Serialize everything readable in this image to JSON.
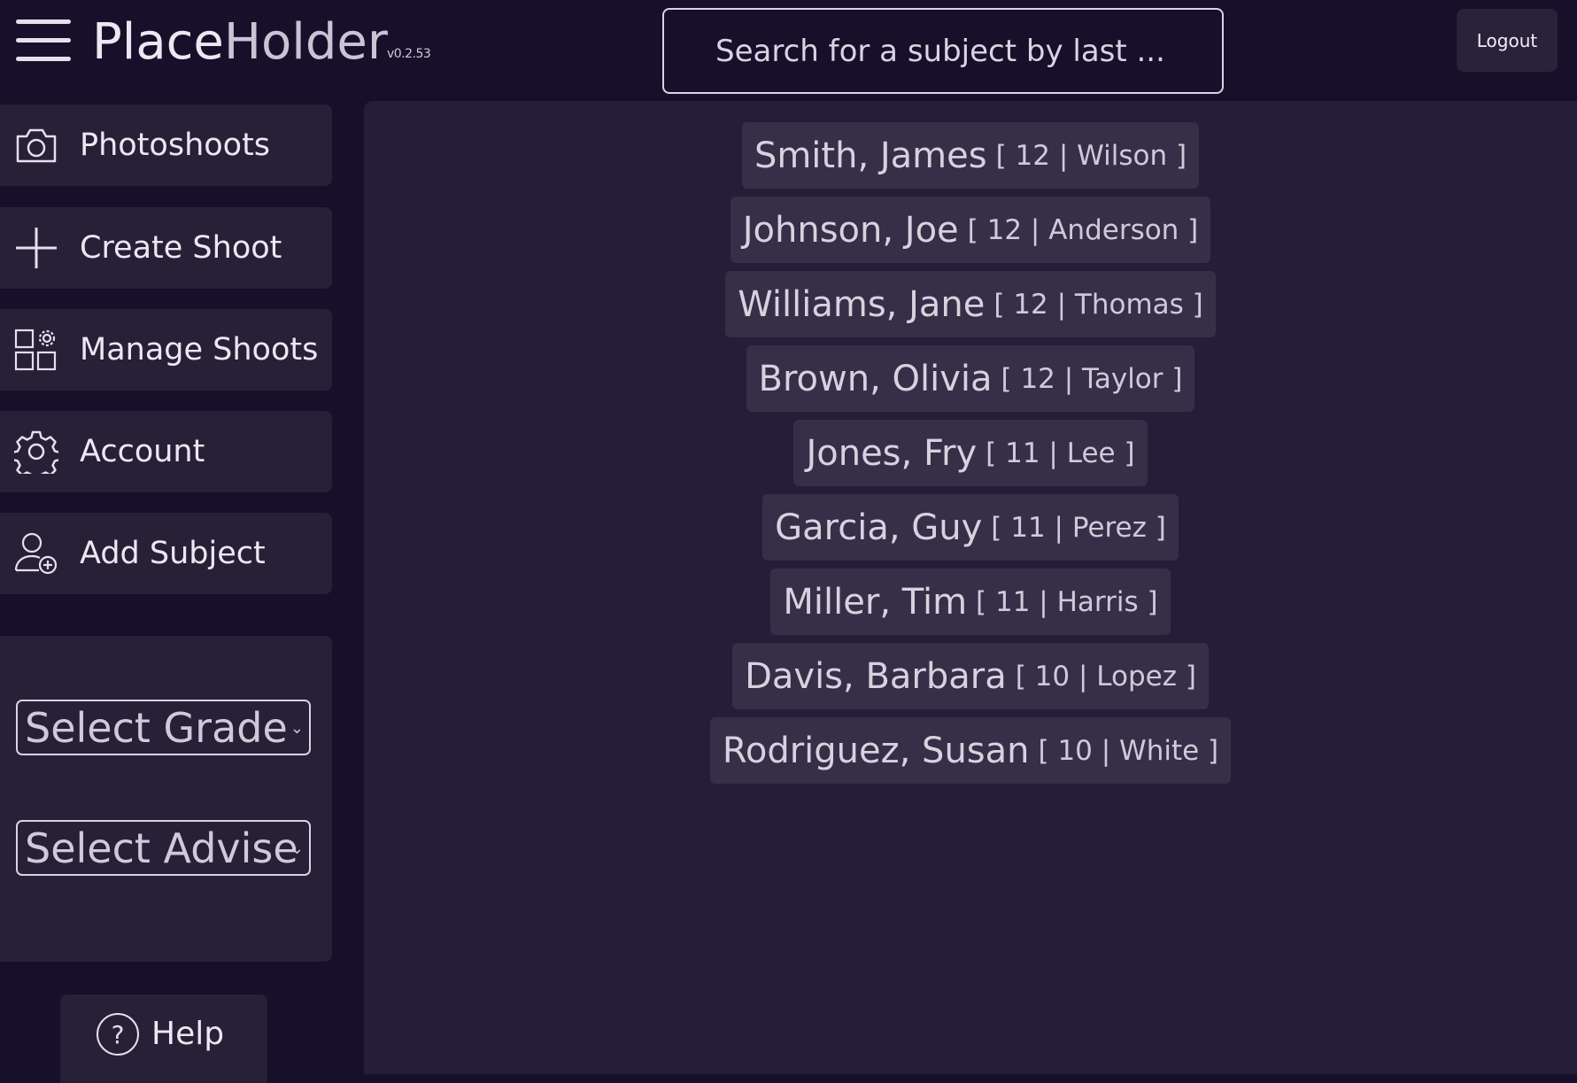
{
  "header": {
    "logo_part1": "Place",
    "logo_part2": "Holder",
    "version": "v0.2.53",
    "search_placeholder": "Search for a subject by last ...",
    "logout_label": "Logout"
  },
  "sidebar": {
    "items": [
      {
        "label": "Photoshoots",
        "icon": "camera-icon"
      },
      {
        "label": "Create Shoot",
        "icon": "plus-icon"
      },
      {
        "label": "Manage Shoots",
        "icon": "grid-settings-icon"
      },
      {
        "label": "Account",
        "icon": "gear-icon"
      },
      {
        "label": "Add Subject",
        "icon": "user-add-icon"
      }
    ],
    "filters": {
      "grade_select": "Select Grade",
      "advisor_select": "Select Advise"
    },
    "help_label": "Help"
  },
  "subjects": [
    {
      "name": "Smith, James",
      "meta": "[ 12 | Wilson ]"
    },
    {
      "name": "Johnson, Joe",
      "meta": "[ 12 | Anderson ]"
    },
    {
      "name": "Williams, Jane",
      "meta": "[ 12 | Thomas ]"
    },
    {
      "name": "Brown, Olivia",
      "meta": "[ 12 | Taylor ]"
    },
    {
      "name": "Jones, Fry",
      "meta": "[ 11 | Lee ]"
    },
    {
      "name": "Garcia, Guy",
      "meta": "[ 11 | Perez ]"
    },
    {
      "name": "Miller, Tim",
      "meta": "[ 11 | Harris ]"
    },
    {
      "name": "Davis, Barbara",
      "meta": "[ 10 | Lopez ]"
    },
    {
      "name": "Rodriguez, Susan",
      "meta": "[ 10 | White ]"
    }
  ],
  "colors": {
    "background": "#17102b",
    "panel": "#282037",
    "content": "#261d38",
    "chip": "#372e48",
    "text": "#e4e0ec"
  }
}
